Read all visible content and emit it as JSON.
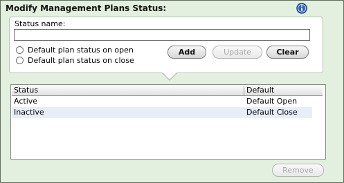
{
  "title": "Modify Management Plans Status:",
  "info_icon": "info-icon",
  "form": {
    "status_label": "Status name:",
    "status_value": "",
    "radio_open_label": "Default plan status on open",
    "radio_close_label": "Default plan status on close",
    "add_label": "Add",
    "update_label": "Update",
    "clear_label": "Clear"
  },
  "table": {
    "headers": [
      "Status",
      "Default"
    ],
    "rows": [
      {
        "status": "Active",
        "default": "Default Open"
      },
      {
        "status": "Inactive",
        "default": "Default Close"
      }
    ]
  },
  "remove_label": "Remove",
  "colors": {
    "background": "#e3efdf",
    "info_blue": "#2a5fc7",
    "alt_row": "#e7eef8"
  }
}
